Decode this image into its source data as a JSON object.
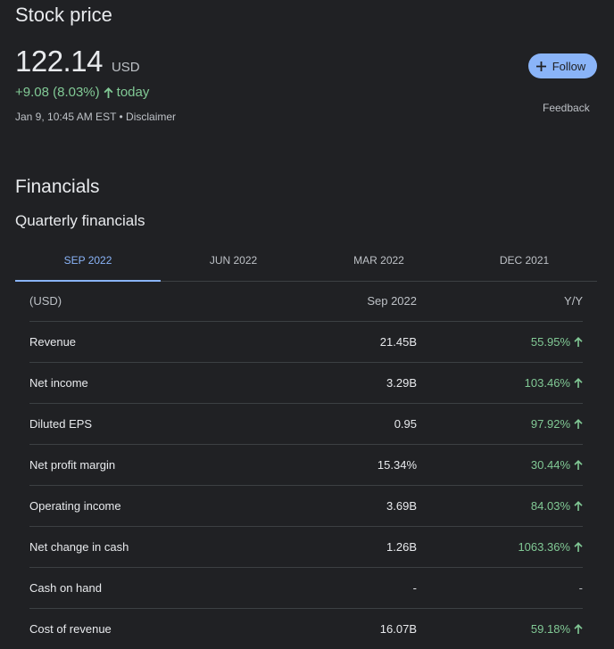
{
  "header": {
    "title": "Stock price",
    "price": "122.14",
    "currency": "USD",
    "change": "+9.08 (8.03%)",
    "change_period": "today",
    "timestamp": "Jan 9, 10:45 AM EST • Disclaimer",
    "follow_label": "Follow",
    "feedback_label": "Feedback"
  },
  "financials": {
    "title": "Financials",
    "subtitle": "Quarterly financials",
    "tabs": [
      {
        "label": "SEP 2022",
        "active": true
      },
      {
        "label": "JUN 2022",
        "active": false
      },
      {
        "label": "MAR 2022",
        "active": false
      },
      {
        "label": "DEC 2021",
        "active": false
      }
    ],
    "table": {
      "headers": [
        "(USD)",
        "Sep 2022",
        "Y/Y"
      ],
      "rows": [
        {
          "label": "Revenue",
          "value": "21.45B",
          "yy": "55.95%",
          "up": true
        },
        {
          "label": "Net income",
          "value": "3.29B",
          "yy": "103.46%",
          "up": true
        },
        {
          "label": "Diluted EPS",
          "value": "0.95",
          "yy": "97.92%",
          "up": true
        },
        {
          "label": "Net profit margin",
          "value": "15.34%",
          "yy": "30.44%",
          "up": true
        },
        {
          "label": "Operating income",
          "value": "3.69B",
          "yy": "84.03%",
          "up": true
        },
        {
          "label": "Net change in cash",
          "value": "1.26B",
          "yy": "1063.36%",
          "up": true
        },
        {
          "label": "Cash on hand",
          "value": "-",
          "yy": "-",
          "up": false
        },
        {
          "label": "Cost of revenue",
          "value": "16.07B",
          "yy": "59.18%",
          "up": true
        }
      ]
    }
  },
  "colors": {
    "background": "#202124",
    "positive": "#81c995",
    "accent": "#8ab4f8"
  }
}
